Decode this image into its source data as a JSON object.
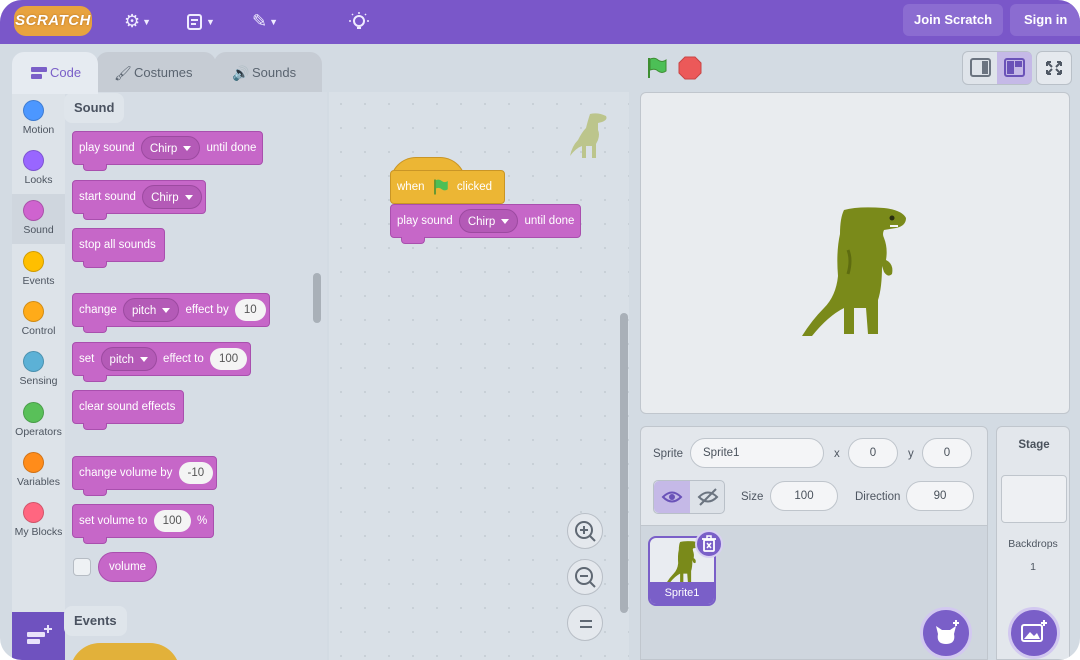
{
  "menu": {
    "logo_text": "SCRATCH",
    "join_label": "Join Scratch",
    "signin_label": "Sign in",
    "icons": [
      "gear-icon",
      "file-icon",
      "edit-icon",
      "lightbulb-icon"
    ]
  },
  "tabs": [
    {
      "label": "Code",
      "icon": "code-icon",
      "active": true
    },
    {
      "label": "Costumes",
      "icon": "brush-icon",
      "active": false
    },
    {
      "label": "Sounds",
      "icon": "speaker-icon",
      "active": false
    }
  ],
  "categories": [
    {
      "label": "Motion",
      "color": "#4c97ff"
    },
    {
      "label": "Looks",
      "color": "#9966ff"
    },
    {
      "label": "Sound",
      "color": "#cf63cf"
    },
    {
      "label": "Events",
      "color": "#ffbf00"
    },
    {
      "label": "Control",
      "color": "#ffab19"
    },
    {
      "label": "Sensing",
      "color": "#5cb1d6"
    },
    {
      "label": "Operators",
      "color": "#59c059"
    },
    {
      "label": "Variables",
      "color": "#ff8c1a"
    },
    {
      "label": "My Blocks",
      "color": "#ff6680"
    }
  ],
  "palette": {
    "sound_heading": "Sound",
    "events_heading": "Events",
    "play_until_done": {
      "text1": "play sound",
      "menu": "Chirp",
      "text2": "until done"
    },
    "start_sound": {
      "text1": "start sound",
      "menu": "Chirp"
    },
    "stop_all": {
      "text1": "stop all sounds"
    },
    "change_effect": {
      "text1": "change",
      "menu": "pitch",
      "text2": "effect by",
      "value": "10"
    },
    "set_effect": {
      "text1": "set",
      "menu": "pitch",
      "text2": "effect to",
      "value": "100"
    },
    "clear_effects": {
      "text1": "clear sound effects"
    },
    "change_volume": {
      "text1": "change volume by",
      "value": "-10"
    },
    "set_volume": {
      "text1": "set volume to",
      "value": "100",
      "unit": "%"
    },
    "volume_reporter": "volume"
  },
  "script": {
    "hat": {
      "text1": "when",
      "text2": "clicked"
    },
    "play": {
      "text1": "play sound",
      "menu": "Chirp",
      "text2": "until done"
    }
  },
  "sprite_info": {
    "sprite_label": "Sprite",
    "sprite_name": "Sprite1",
    "x_label": "x",
    "x_value": "0",
    "y_label": "y",
    "y_value": "0",
    "size_label": "Size",
    "size_value": "100",
    "direction_label": "Direction",
    "direction_value": "90"
  },
  "sprites": [
    {
      "name": "Sprite1"
    }
  ],
  "stage_pane": {
    "title": "Stage",
    "backdrops_label": "Backdrops",
    "backdrops_count": "1"
  },
  "colors": {
    "menubar": "#7a57c9",
    "sound_block": "#c667c8",
    "events_block": "#ecb634",
    "dino": "#7a8a1a"
  }
}
